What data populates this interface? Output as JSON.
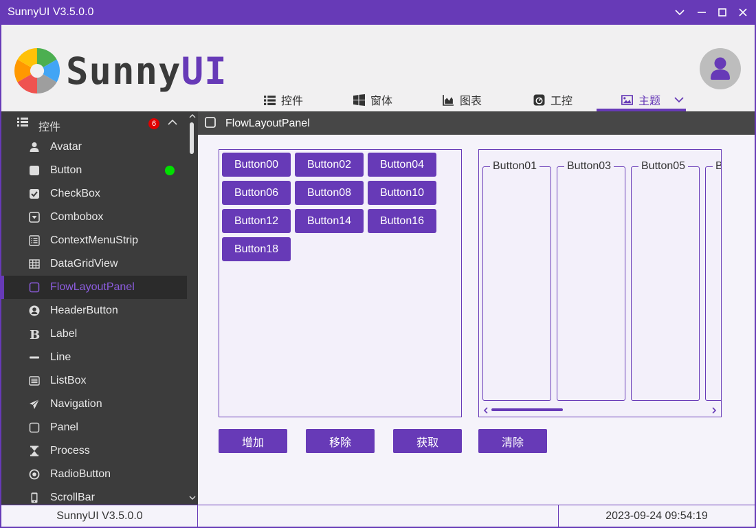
{
  "window": {
    "title": "SunnyUI V3.5.0.0"
  },
  "header": {
    "logo_text_sunny": "Sunny",
    "logo_text_ui": "UI",
    "nav": [
      {
        "label": "控件",
        "icon": "list-icon"
      },
      {
        "label": "窗体",
        "icon": "windows-icon"
      },
      {
        "label": "图表",
        "icon": "area-chart-icon"
      },
      {
        "label": "工控",
        "icon": "tachometer-icon"
      },
      {
        "label": "主题",
        "icon": "image-icon",
        "active": true
      }
    ]
  },
  "sidebar": {
    "header_label": "控件",
    "header_badge": "6",
    "items": [
      {
        "label": "Avatar",
        "icon": "user-icon"
      },
      {
        "label": "Button",
        "icon": "square-icon",
        "status": "online"
      },
      {
        "label": "CheckBox",
        "icon": "check-square-icon"
      },
      {
        "label": "Combobox",
        "icon": "caret-square-down-icon"
      },
      {
        "label": "ContextMenuStrip",
        "icon": "list-alt-icon"
      },
      {
        "label": "DataGridView",
        "icon": "table-icon"
      },
      {
        "label": "FlowLayoutPanel",
        "icon": "square-outline-icon",
        "selected": true
      },
      {
        "label": "HeaderButton",
        "icon": "user-circle-icon"
      },
      {
        "label": "Label",
        "icon": "bold-icon"
      },
      {
        "label": "Line",
        "icon": "minus-icon"
      },
      {
        "label": "ListBox",
        "icon": "list-box-icon"
      },
      {
        "label": "Navigation",
        "icon": "paper-plane-icon"
      },
      {
        "label": "Panel",
        "icon": "square-outline-icon"
      },
      {
        "label": "Process",
        "icon": "hourglass-icon"
      },
      {
        "label": "RadioButton",
        "icon": "dot-circle-icon"
      },
      {
        "label": "ScrollBar",
        "icon": "mobile-icon"
      }
    ]
  },
  "content": {
    "title": "FlowLayoutPanel",
    "flow_buttons": [
      "Button00",
      "Button02",
      "Button04",
      "Button06",
      "Button08",
      "Button10",
      "Button12",
      "Button14",
      "Button16",
      "Button18"
    ],
    "groups": [
      "Button01",
      "Button03",
      "Button05",
      "B"
    ],
    "actions": [
      "增加",
      "移除",
      "获取",
      "清除"
    ]
  },
  "status": {
    "version": "SunnyUI V3.5.0.0",
    "middle": "",
    "datetime": "2023-09-24 09:54:19"
  },
  "colors": {
    "accent": "#673AB7",
    "sidebar_bg": "#3C3C3C",
    "online": "#00E000",
    "badge": "#E00000"
  }
}
